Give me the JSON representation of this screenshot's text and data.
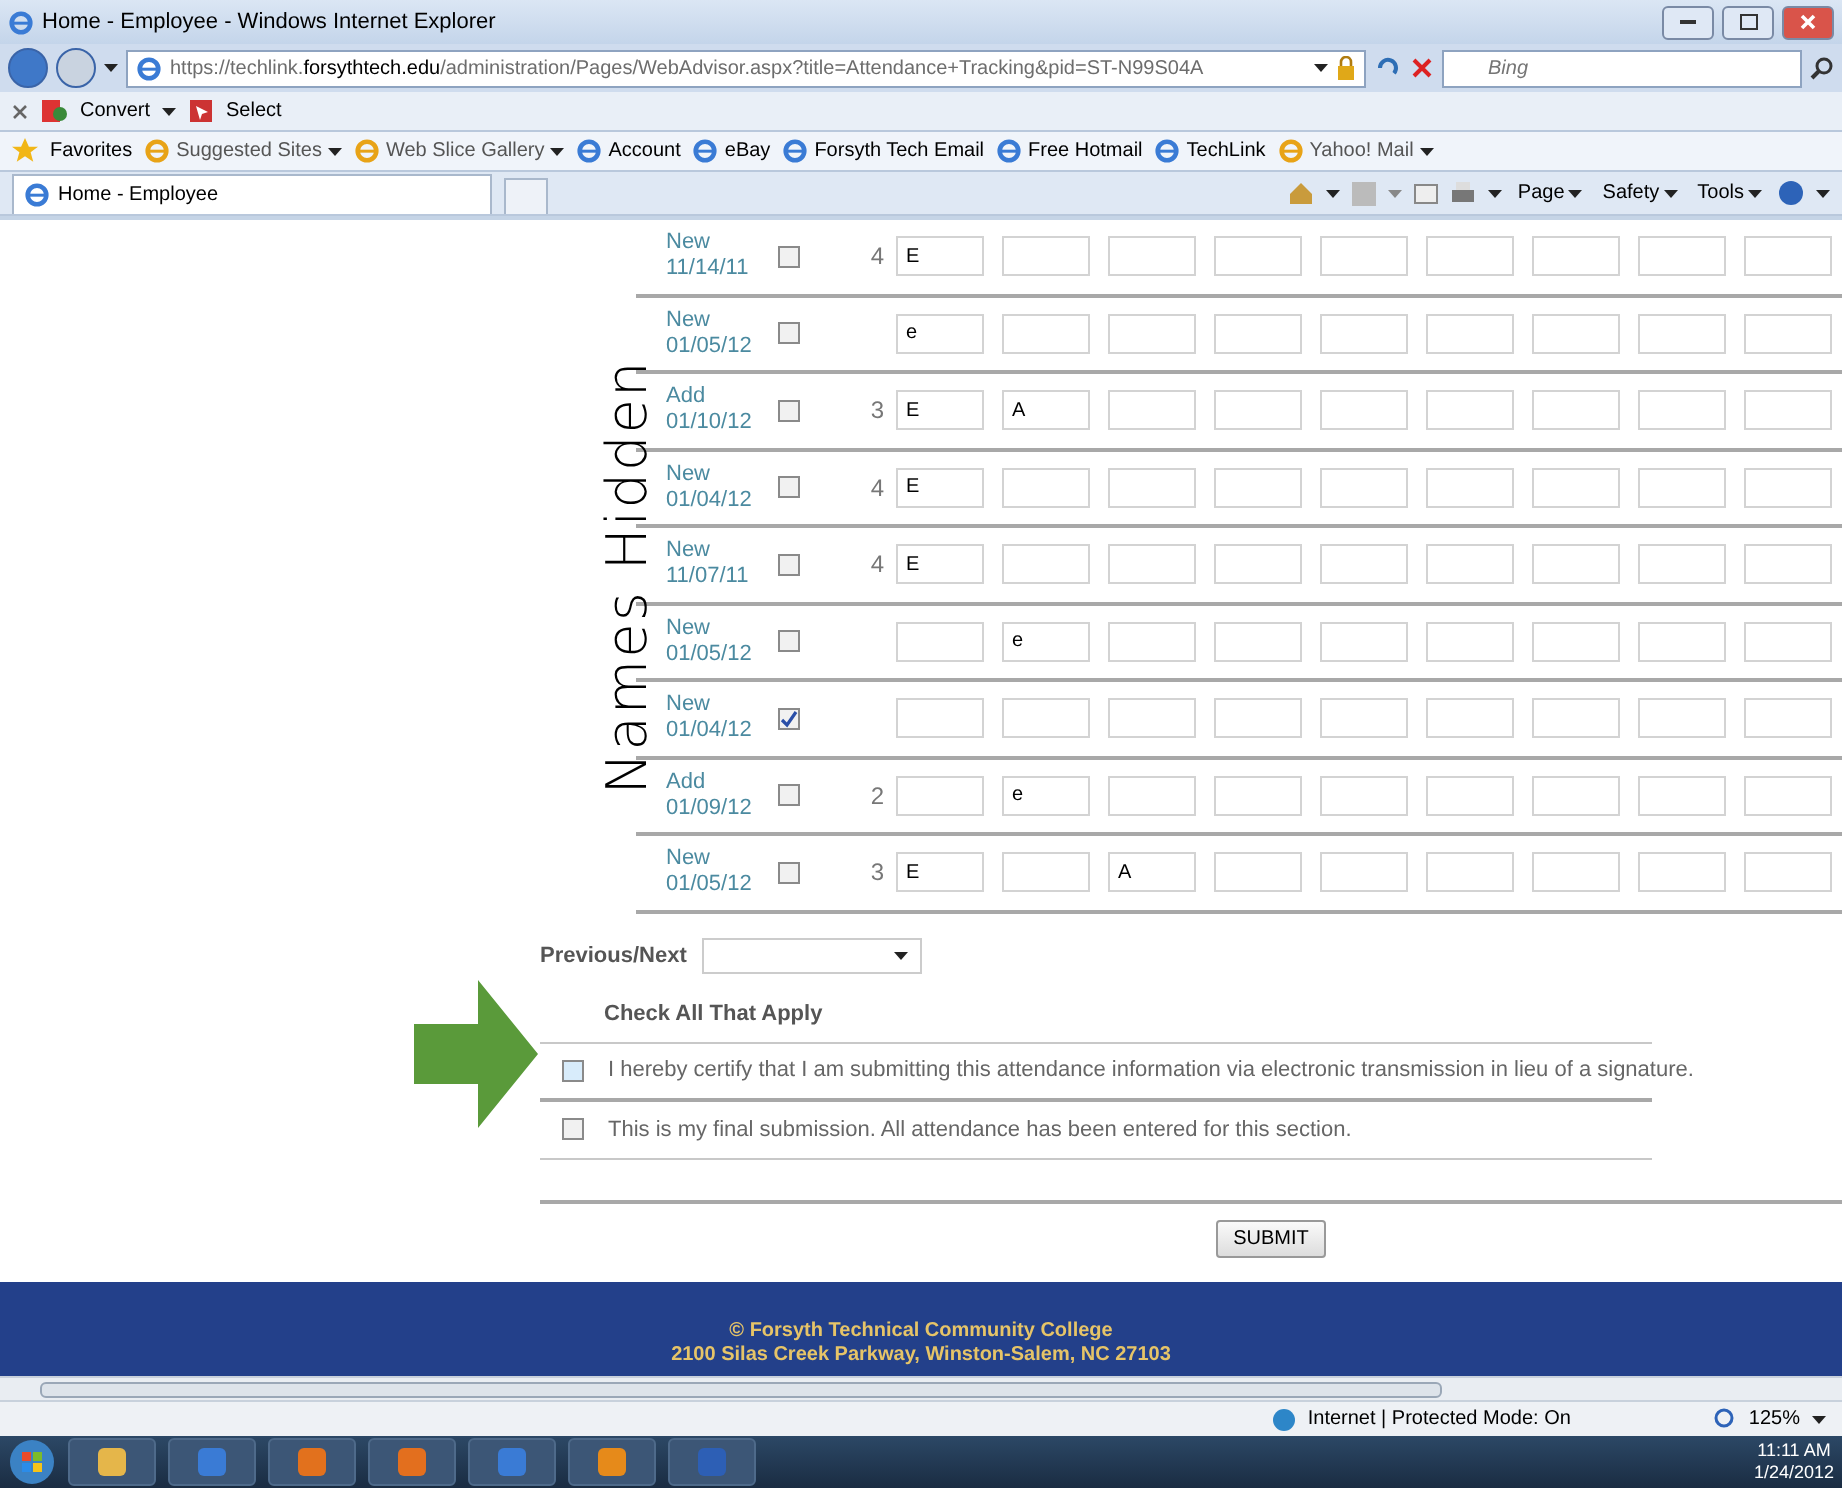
{
  "window": {
    "title": "Home - Employee - Windows Internet Explorer"
  },
  "address_bar": {
    "url": "https://techlink.**forsythtech.edu**/administration/Pages/WebAdvisor.aspx?title=Attendance+Tracking&pid=ST-N99S04A",
    "search_placeholder": "Bing"
  },
  "command_bar": [
    "Convert",
    "Select"
  ],
  "favorites_bar": {
    "label": "Favorites",
    "items": [
      {
        "label": "Suggested Sites",
        "menu": true
      },
      {
        "label": "Web Slice Gallery",
        "menu": true
      },
      {
        "label": "Account",
        "menu": false
      },
      {
        "label": "eBay",
        "menu": false
      },
      {
        "label": "Forsyth Tech Email",
        "menu": false
      },
      {
        "label": "Free Hotmail",
        "menu": false
      },
      {
        "label": "TechLink",
        "menu": false
      },
      {
        "label": "Yahoo! Mail",
        "menu": true
      }
    ]
  },
  "tabs": [
    {
      "label": "Home - Employee",
      "selected": true
    }
  ],
  "tab_toolbar": [
    "Page",
    "Safety",
    "Tools"
  ],
  "annotation": {
    "text": "Names Hidden"
  },
  "rows": [
    {
      "status": "New",
      "date": "11/14/11",
      "checked": false,
      "count": "4",
      "cells": {
        "column_1": "E"
      }
    },
    {
      "status": "New",
      "date": "01/05/12",
      "checked": false,
      "cells": {
        "column_1": "e"
      }
    },
    {
      "status": "Add",
      "date": "01/10/12",
      "checked": false,
      "count": "3",
      "cells": {
        "column_1": "E",
        "column_2": "A"
      }
    },
    {
      "status": "New",
      "date": "01/04/12",
      "checked": false,
      "count": "4",
      "cells": {
        "column_1": "E"
      }
    },
    {
      "status": "New",
      "date": "11/07/11",
      "checked": false,
      "count": "4",
      "cells": {
        "column_1": "E"
      }
    },
    {
      "status": "New",
      "date": "01/05/12",
      "checked": false,
      "cells": {
        "column_2": "e"
      }
    },
    {
      "status": "New",
      "date": "01/04/12",
      "checked": true
    },
    {
      "status": "Add",
      "date": "01/09/12",
      "checked": false,
      "count": "2",
      "cells": {
        "column_2": "e"
      }
    },
    {
      "status": "New",
      "date": "01/05/12",
      "checked": false,
      "count": "3",
      "cells": {
        "column_1": "E",
        "column_3": "A"
      }
    }
  ],
  "previous_next": {
    "label": "Previous/Next"
  },
  "check_all": {
    "heading": "Check All That Apply",
    "items": [
      {
        "label": "I hereby certify that I am submitting this attendance information via electronic transmission in lieu of a signature.",
        "checked": false,
        "focused": true
      },
      {
        "label": "This is my final submission. All attendance has been entered for this section.",
        "checked": false,
        "focused": false
      }
    ]
  },
  "submit_button": "SUBMIT",
  "footer": [
    "© Forsyth Technical Community College",
    "2100 Silas Creek Parkway, Winston-Salem, NC 27103"
  ],
  "status_bar": {
    "zone": "Internet | Protected Mode: On",
    "zoom": "125%"
  },
  "taskbar": {
    "time": "11:11 AM",
    "date": "1/24/2012"
  }
}
